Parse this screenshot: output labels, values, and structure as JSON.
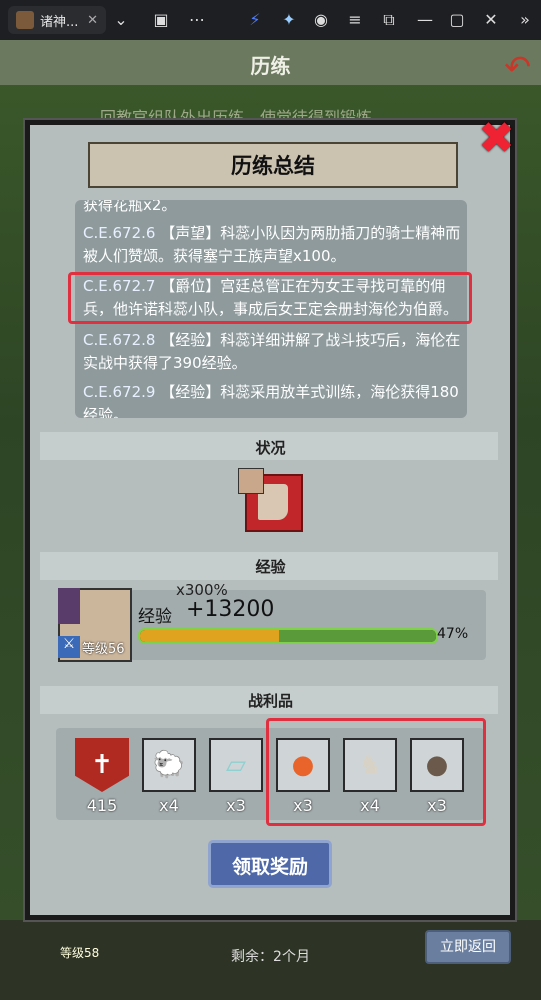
{
  "browser": {
    "tab_title": "诸神...",
    "tab_close": "✕"
  },
  "header": {
    "title": "历练",
    "hint_text": "回教官组队外出历练，使觉徒得到锻炼"
  },
  "panel": {
    "title": "历练总结",
    "log": [
      {
        "date": "",
        "text": "获得花瓶x2。"
      },
      {
        "date": "C.E.672.6",
        "text": "【声望】科蕊小队因为两肋插刀的骑士精神而被人们赞颂。获得塞宁王族声望x100。"
      },
      {
        "date": "C.E.672.7",
        "text": "【爵位】宫廷总管正在为女王寻找可靠的佣兵，他许诺科蕊小队，事成后女王定会册封海伦为伯爵。"
      },
      {
        "date": "C.E.672.8",
        "text": "【经验】科蕊详细讲解了战斗技巧后，海伦在实战中获得了390经验。"
      },
      {
        "date": "C.E.672.9",
        "text": "【经验】科蕊采用放羊式训练，海伦获得180经验。"
      }
    ],
    "status_label": "状况",
    "exp_section_label": "经验",
    "exp": {
      "multiplier": "x300%",
      "label": "经验",
      "value": "+13200",
      "percent_text": "47%",
      "progress_old": 0.47,
      "progress_new_end": 1.0,
      "level_text": "等级56"
    },
    "loot_label": "战利品",
    "loot": [
      {
        "name": "crest",
        "count": "415",
        "color": "#b02a22"
      },
      {
        "name": "sheep",
        "count": "x4",
        "color": "#e8e4d8"
      },
      {
        "name": "cloth",
        "count": "x3",
        "color": "#8fd0d0"
      },
      {
        "name": "roe",
        "count": "x3",
        "color": "#e8642a"
      },
      {
        "name": "horse",
        "count": "x4",
        "color": "#d8d2c6"
      },
      {
        "name": "truffle",
        "count": "x3",
        "color": "#6b5a4c"
      }
    ],
    "claim_label": "领取奖励"
  },
  "bottom": {
    "remain": "剩余：2个月",
    "return_label": "立即返回",
    "level_text": "等级58"
  },
  "colors": {
    "highlight": "#e03040",
    "close": "#e22233"
  }
}
